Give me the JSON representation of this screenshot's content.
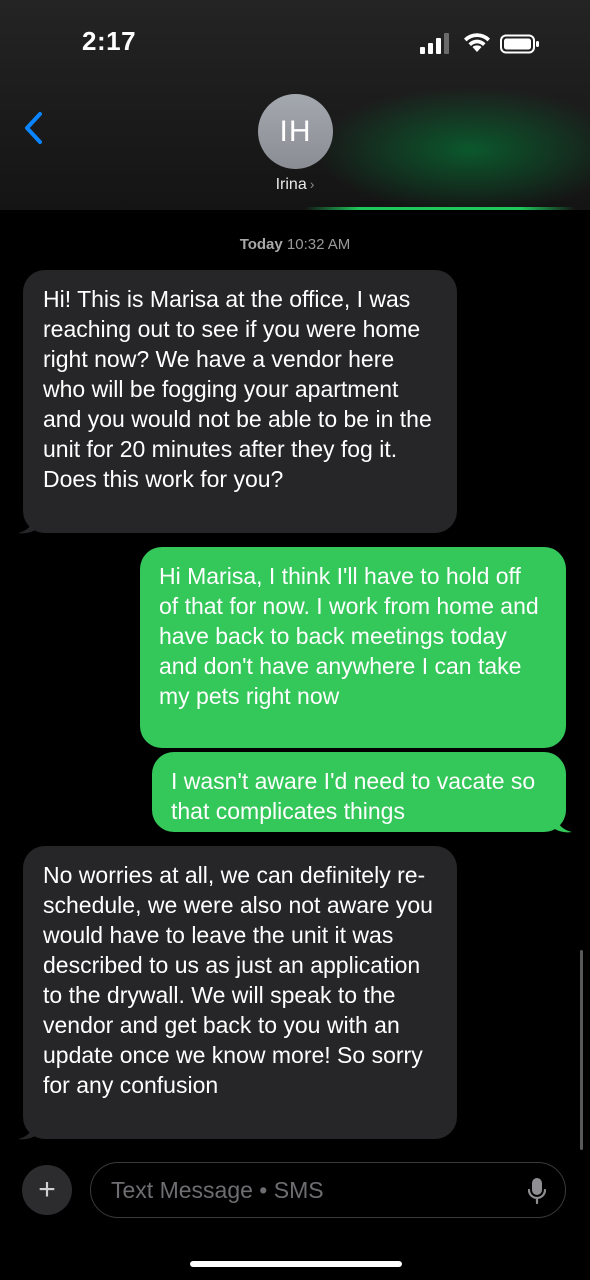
{
  "status_bar": {
    "time": "2:17"
  },
  "contact": {
    "initials": "IH",
    "name": "Irina"
  },
  "conversation": {
    "timestamp_day": "Today",
    "timestamp_time": "10:32 AM",
    "messages": [
      {
        "direction": "incoming",
        "text": "Hi! This is Marisa at the office, I was reaching out to see if you were home right now? We have a vendor here who will be fogging your apartment and you would not be able to be in the unit for 20 minutes after they fog it. Does this work for you?"
      },
      {
        "direction": "outgoing",
        "text": "Hi Marisa, I think I'll have to hold off of that for now. I work from home and have back to back meetings today and don't have anywhere I can take my pets right now"
      },
      {
        "direction": "outgoing",
        "text": "I wasn't aware I'd need to vacate so that complicates things"
      },
      {
        "direction": "incoming",
        "text": "No worries at all, we can definitely re-schedule, we were also not aware you would have to leave the unit it was described to us as just an application to the drywall. We will speak to the vendor and get back to you with an update once we know more! So sorry for any confusion"
      }
    ]
  },
  "composer": {
    "plus_symbol": "+",
    "placeholder": "Text Message • SMS"
  },
  "icons": {
    "back": "chevron-left-icon",
    "mic": "microphone-icon",
    "signal": "cellular-signal-icon",
    "wifi": "wifi-icon",
    "battery": "battery-icon"
  },
  "colors": {
    "outgoing_bubble": "#34c759",
    "incoming_bubble": "#262628",
    "back_accent": "#0a84ff"
  }
}
